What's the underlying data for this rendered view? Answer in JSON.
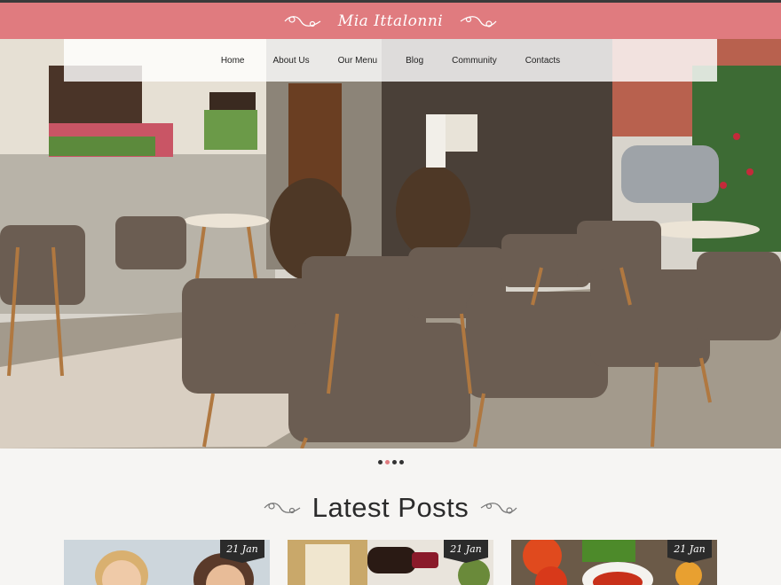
{
  "brand": {
    "name": "Mia Ittalonni"
  },
  "nav": {
    "items": [
      "Home",
      "About Us",
      "Our Menu",
      "Blog",
      "Community",
      "Contacts"
    ]
  },
  "slider": {
    "dots": 4,
    "active_index": 1
  },
  "latest_posts": {
    "title": "Latest Posts",
    "posts": [
      {
        "date": "21 Jan",
        "thumb": "people-photo"
      },
      {
        "date": "21 Jan",
        "thumb": "wine-photo"
      },
      {
        "date": "21 Jan",
        "thumb": "food-photo"
      }
    ]
  },
  "colors": {
    "accent": "#e07b7f",
    "dark": "#2b2b2b",
    "background": "#f6f5f3"
  }
}
